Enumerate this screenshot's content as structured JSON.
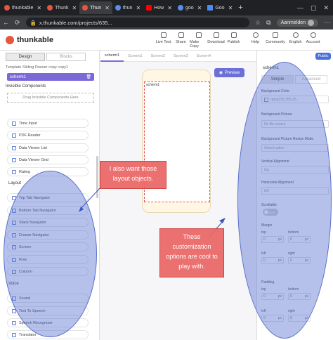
{
  "browser": {
    "tabs": [
      {
        "label": "thunkable",
        "active": false,
        "favicon_color": "#e8553e"
      },
      {
        "label": "Thunk",
        "active": false,
        "favicon_color": "#e8553e"
      },
      {
        "label": "Thun",
        "active": true,
        "favicon_color": "#e8553e"
      },
      {
        "label": "thun",
        "active": false,
        "favicon_color": "#5a8dee"
      },
      {
        "label": "How",
        "active": false,
        "favicon_color": "#ff0000"
      },
      {
        "label": "goo",
        "active": false,
        "favicon_color": "#5a8dee"
      },
      {
        "label": "Goo",
        "active": false,
        "favicon_color": "#4c8bf5"
      }
    ],
    "url": "x.thunkable.com/projects/635...",
    "profile_label": "Aanmelden"
  },
  "app": {
    "name": "thunkable",
    "toolbar": [
      "Live Test",
      "Share",
      "Make Copy",
      "Download",
      "Publish",
      "Help",
      "Community",
      "English",
      "Account"
    ]
  },
  "left_panel": {
    "tabs": [
      "Design",
      "Blocks"
    ],
    "project_name": "Template Sliding Drawer copy copy1",
    "screen_name": "scherm1",
    "invisible_label": "Invisible Components",
    "drag_hint": "Drag Invisible Components Here",
    "components_top": [
      "Time Input",
      "PDF Reader",
      "Data Viewer List",
      "Data Viewer Grid",
      "Rating"
    ],
    "layout_section": "Layout",
    "layout_items": [
      "Top Tab Navigator",
      "Bottom Tab Navigator",
      "Stack Navigator",
      "Drawer Navigator",
      "Screen",
      "Row",
      "Column"
    ],
    "voice_section": "Voice",
    "voice_items": [
      "Sound",
      "Text To Speech",
      "Speech Recognizer",
      "Translator"
    ]
  },
  "center": {
    "tabs": [
      "scherm1",
      "Screen1",
      "Screen2",
      "Screen3",
      "Screen4"
    ],
    "phone_label": "scherm1",
    "preview_label": "Preview"
  },
  "right_panel": {
    "public_label": "Public",
    "component_title": "scherm1",
    "tabs": [
      "Simple",
      "Advanced"
    ],
    "props": {
      "bg_color_label": "Background Color",
      "bg_color_value": "rgba(255,255,25...",
      "bg_picture_label": "Background Picture",
      "bg_picture_value": "No file source",
      "bg_resize_label": "Background Picture Resize Mode",
      "bg_resize_value": "Select option",
      "v_align_label": "Vertical Alignment",
      "v_align_value": "top",
      "h_align_label": "Horizontal Alignment",
      "h_align_value": "left",
      "scrollable_label": "Scrollable",
      "scrollable_value": "false",
      "margin_label": "Margin",
      "padding_label": "Padding",
      "side_top": "top",
      "side_bottom": "bottom",
      "side_left": "left",
      "side_right": "right",
      "unit": "px",
      "zero": "0"
    }
  },
  "annotations": {
    "left_note": "I also want those layout objects.",
    "right_note": "These customization options are cool to play with."
  }
}
